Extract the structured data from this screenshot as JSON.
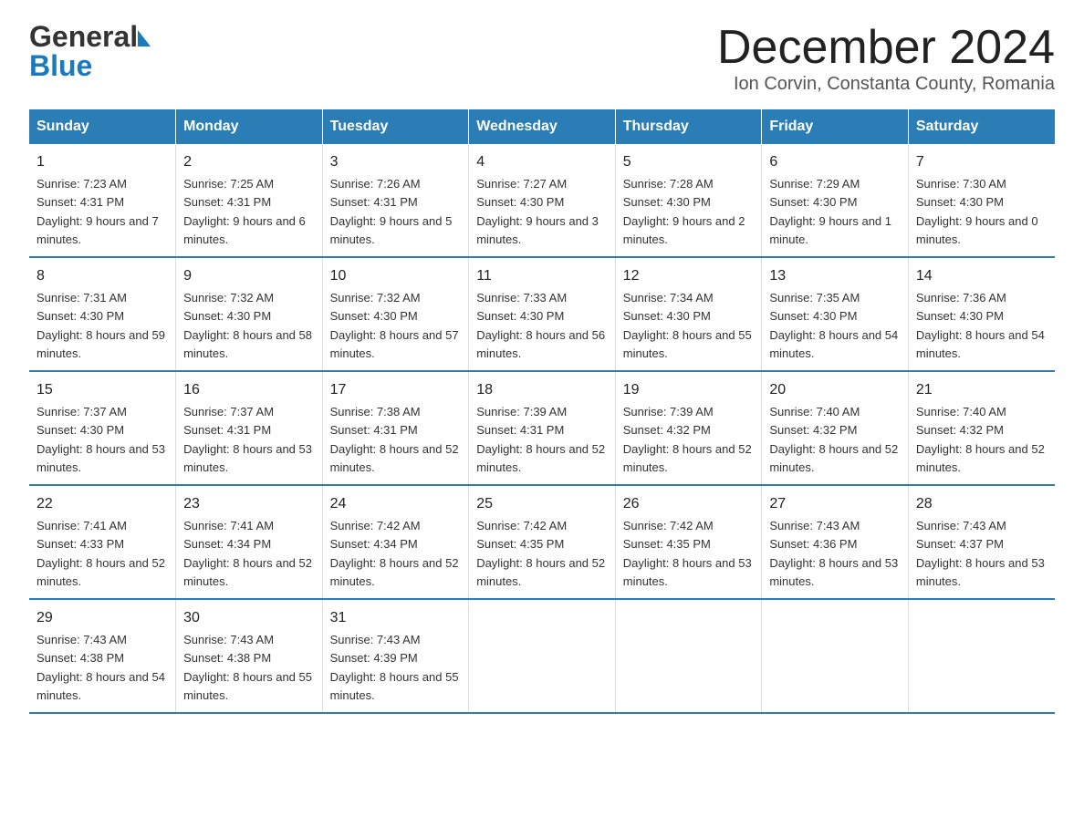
{
  "header": {
    "logo_line1": "General",
    "logo_line2": "Blue",
    "title": "December 2024",
    "subtitle": "Ion Corvin, Constanta County, Romania"
  },
  "columns": [
    "Sunday",
    "Monday",
    "Tuesday",
    "Wednesday",
    "Thursday",
    "Friday",
    "Saturday"
  ],
  "weeks": [
    [
      {
        "day": "1",
        "sunrise": "7:23 AM",
        "sunset": "4:31 PM",
        "daylight": "9 hours and 7 minutes."
      },
      {
        "day": "2",
        "sunrise": "7:25 AM",
        "sunset": "4:31 PM",
        "daylight": "9 hours and 6 minutes."
      },
      {
        "day": "3",
        "sunrise": "7:26 AM",
        "sunset": "4:31 PM",
        "daylight": "9 hours and 5 minutes."
      },
      {
        "day": "4",
        "sunrise": "7:27 AM",
        "sunset": "4:30 PM",
        "daylight": "9 hours and 3 minutes."
      },
      {
        "day": "5",
        "sunrise": "7:28 AM",
        "sunset": "4:30 PM",
        "daylight": "9 hours and 2 minutes."
      },
      {
        "day": "6",
        "sunrise": "7:29 AM",
        "sunset": "4:30 PM",
        "daylight": "9 hours and 1 minute."
      },
      {
        "day": "7",
        "sunrise": "7:30 AM",
        "sunset": "4:30 PM",
        "daylight": "9 hours and 0 minutes."
      }
    ],
    [
      {
        "day": "8",
        "sunrise": "7:31 AM",
        "sunset": "4:30 PM",
        "daylight": "8 hours and 59 minutes."
      },
      {
        "day": "9",
        "sunrise": "7:32 AM",
        "sunset": "4:30 PM",
        "daylight": "8 hours and 58 minutes."
      },
      {
        "day": "10",
        "sunrise": "7:32 AM",
        "sunset": "4:30 PM",
        "daylight": "8 hours and 57 minutes."
      },
      {
        "day": "11",
        "sunrise": "7:33 AM",
        "sunset": "4:30 PM",
        "daylight": "8 hours and 56 minutes."
      },
      {
        "day": "12",
        "sunrise": "7:34 AM",
        "sunset": "4:30 PM",
        "daylight": "8 hours and 55 minutes."
      },
      {
        "day": "13",
        "sunrise": "7:35 AM",
        "sunset": "4:30 PM",
        "daylight": "8 hours and 54 minutes."
      },
      {
        "day": "14",
        "sunrise": "7:36 AM",
        "sunset": "4:30 PM",
        "daylight": "8 hours and 54 minutes."
      }
    ],
    [
      {
        "day": "15",
        "sunrise": "7:37 AM",
        "sunset": "4:30 PM",
        "daylight": "8 hours and 53 minutes."
      },
      {
        "day": "16",
        "sunrise": "7:37 AM",
        "sunset": "4:31 PM",
        "daylight": "8 hours and 53 minutes."
      },
      {
        "day": "17",
        "sunrise": "7:38 AM",
        "sunset": "4:31 PM",
        "daylight": "8 hours and 52 minutes."
      },
      {
        "day": "18",
        "sunrise": "7:39 AM",
        "sunset": "4:31 PM",
        "daylight": "8 hours and 52 minutes."
      },
      {
        "day": "19",
        "sunrise": "7:39 AM",
        "sunset": "4:32 PM",
        "daylight": "8 hours and 52 minutes."
      },
      {
        "day": "20",
        "sunrise": "7:40 AM",
        "sunset": "4:32 PM",
        "daylight": "8 hours and 52 minutes."
      },
      {
        "day": "21",
        "sunrise": "7:40 AM",
        "sunset": "4:32 PM",
        "daylight": "8 hours and 52 minutes."
      }
    ],
    [
      {
        "day": "22",
        "sunrise": "7:41 AM",
        "sunset": "4:33 PM",
        "daylight": "8 hours and 52 minutes."
      },
      {
        "day": "23",
        "sunrise": "7:41 AM",
        "sunset": "4:34 PM",
        "daylight": "8 hours and 52 minutes."
      },
      {
        "day": "24",
        "sunrise": "7:42 AM",
        "sunset": "4:34 PM",
        "daylight": "8 hours and 52 minutes."
      },
      {
        "day": "25",
        "sunrise": "7:42 AM",
        "sunset": "4:35 PM",
        "daylight": "8 hours and 52 minutes."
      },
      {
        "day": "26",
        "sunrise": "7:42 AM",
        "sunset": "4:35 PM",
        "daylight": "8 hours and 53 minutes."
      },
      {
        "day": "27",
        "sunrise": "7:43 AM",
        "sunset": "4:36 PM",
        "daylight": "8 hours and 53 minutes."
      },
      {
        "day": "28",
        "sunrise": "7:43 AM",
        "sunset": "4:37 PM",
        "daylight": "8 hours and 53 minutes."
      }
    ],
    [
      {
        "day": "29",
        "sunrise": "7:43 AM",
        "sunset": "4:38 PM",
        "daylight": "8 hours and 54 minutes."
      },
      {
        "day": "30",
        "sunrise": "7:43 AM",
        "sunset": "4:38 PM",
        "daylight": "8 hours and 55 minutes."
      },
      {
        "day": "31",
        "sunrise": "7:43 AM",
        "sunset": "4:39 PM",
        "daylight": "8 hours and 55 minutes."
      },
      null,
      null,
      null,
      null
    ]
  ],
  "labels": {
    "sunrise": "Sunrise:",
    "sunset": "Sunset:",
    "daylight": "Daylight:"
  }
}
